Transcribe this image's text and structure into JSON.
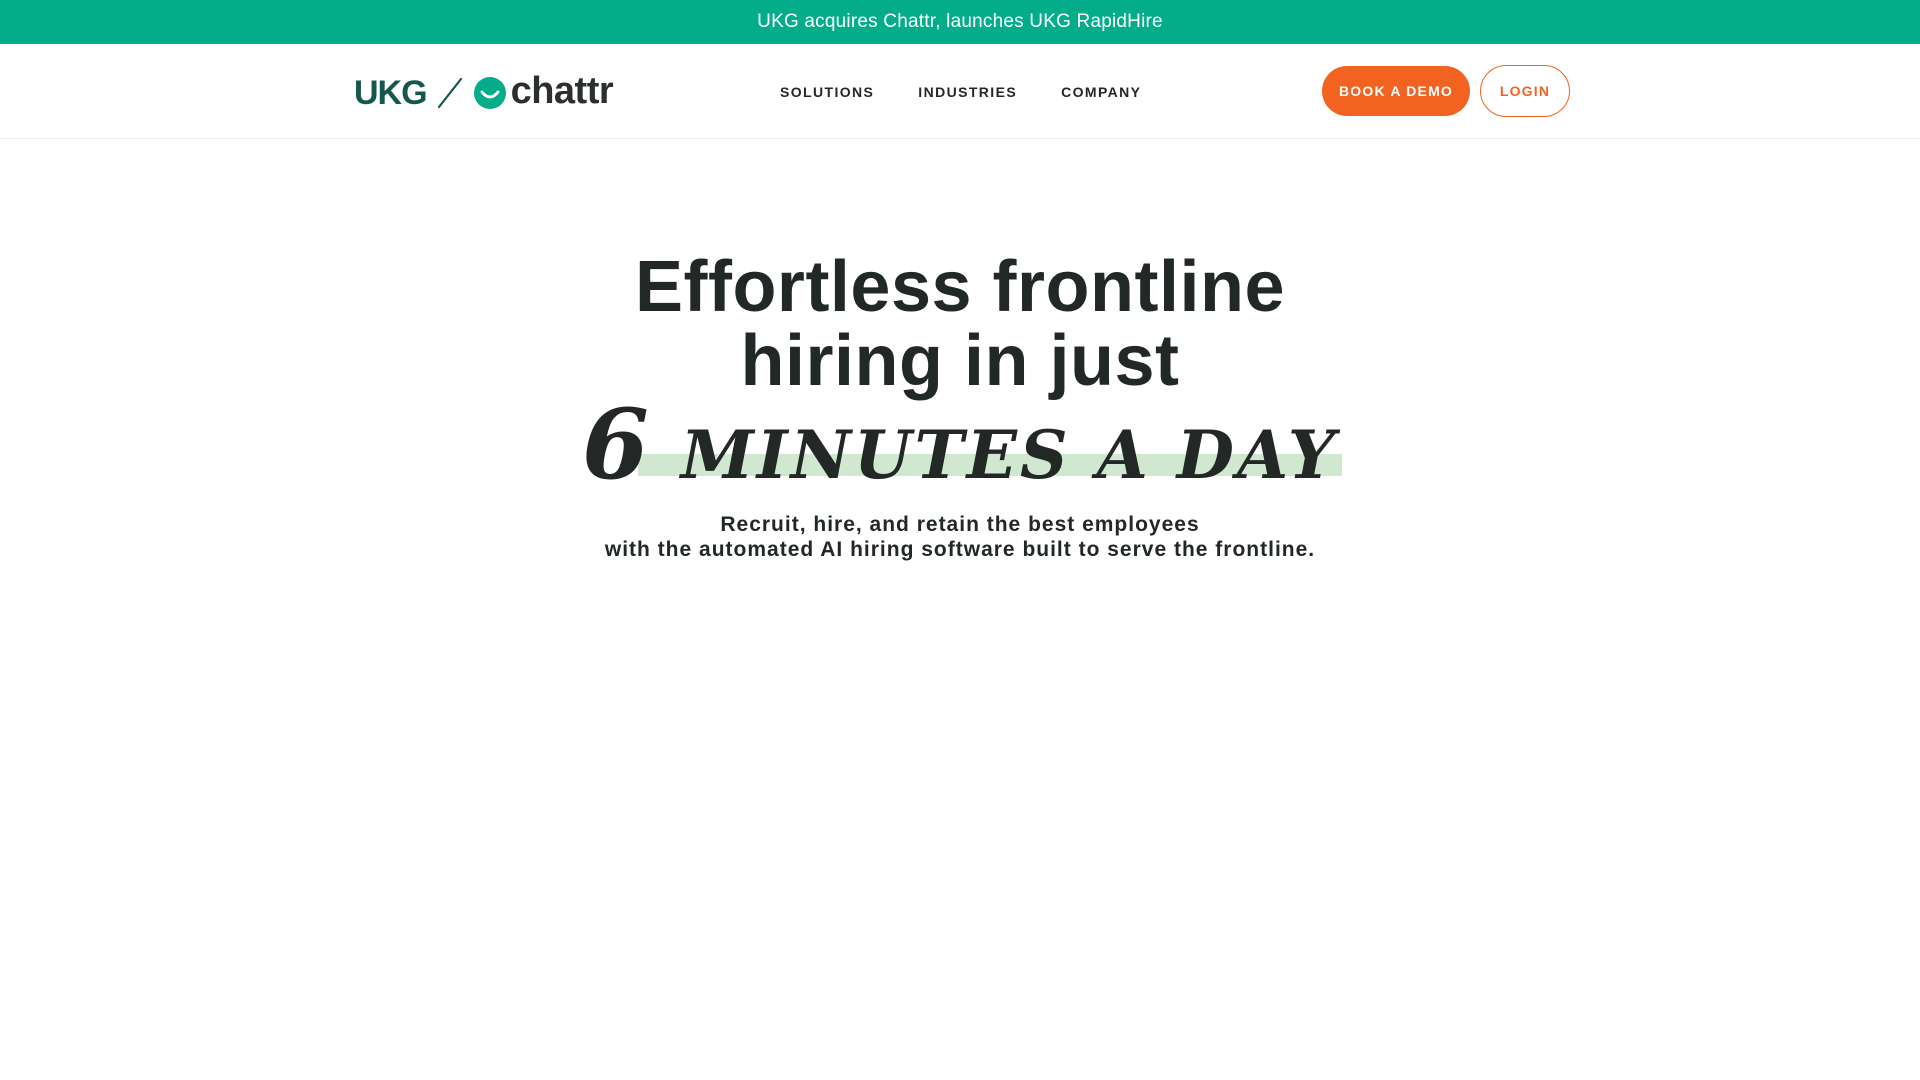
{
  "announcement": {
    "text": "UKG acquires Chattr, launches UKG RapidHire"
  },
  "header": {
    "logo": {
      "ukg_text": "UKG",
      "chattr_text": "chattr"
    },
    "nav": [
      {
        "label": "SOLUTIONS"
      },
      {
        "label": "INDUSTRIES"
      },
      {
        "label": "COMPANY"
      }
    ],
    "book_demo_label": "BOOK A DEMO",
    "login_label": "LOGIN"
  },
  "hero": {
    "title_line1": "Effortless frontline",
    "title_line2": "hiring in just",
    "highlight_number": "6",
    "highlight_text": "MINUTES A DAY",
    "subtitle_line1": "Recruit, hire, and retain the best employees",
    "subtitle_line2": "with the automated AI hiring software built to serve the frontline."
  },
  "colors": {
    "brand_green": "#04ad89",
    "ukg_teal": "#16574d",
    "cta_orange": "#f26321",
    "highlight_green": "#cfe8cf",
    "text_dark": "#222826"
  }
}
